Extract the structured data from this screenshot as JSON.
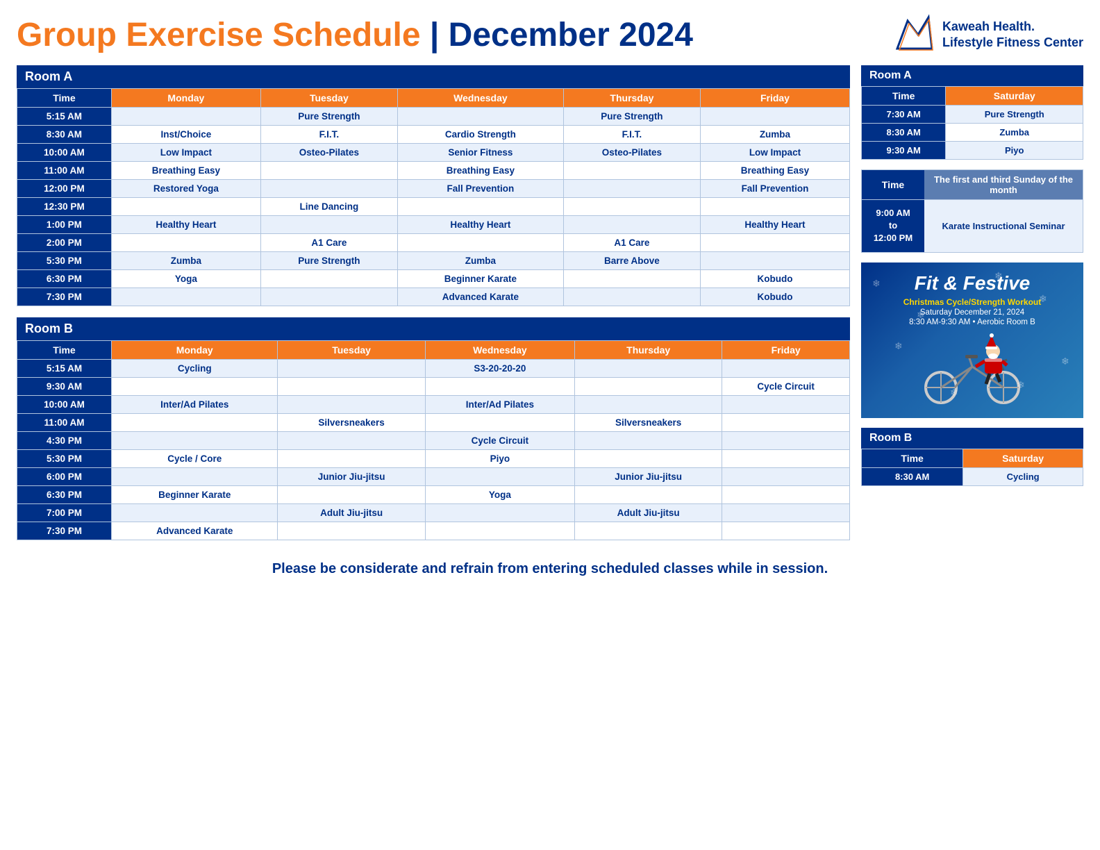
{
  "header": {
    "title_part1": "Group Exercise Schedule",
    "separator": " | ",
    "title_part2": "December 2024",
    "logo_line1": "Kaweah Health.",
    "logo_line2": "Lifestyle Fitness Center"
  },
  "roomA_main": {
    "title": "Room A",
    "columns": [
      "Time",
      "Monday",
      "Tuesday",
      "Wednesday",
      "Thursday",
      "Friday"
    ],
    "rows": [
      [
        "5:15 AM",
        "",
        "Pure Strength",
        "",
        "Pure Strength",
        ""
      ],
      [
        "8:30 AM",
        "Inst/Choice",
        "F.I.T.",
        "Cardio Strength",
        "F.I.T.",
        "Zumba"
      ],
      [
        "10:00 AM",
        "Low Impact",
        "Osteo-Pilates",
        "Senior Fitness",
        "Osteo-Pilates",
        "Low Impact"
      ],
      [
        "11:00 AM",
        "Breathing Easy",
        "",
        "Breathing Easy",
        "",
        "Breathing Easy"
      ],
      [
        "12:00 PM",
        "Restored Yoga",
        "",
        "Fall Prevention",
        "",
        "Fall Prevention"
      ],
      [
        "12:30 PM",
        "",
        "Line Dancing",
        "",
        "",
        ""
      ],
      [
        "1:00 PM",
        "Healthy Heart",
        "",
        "Healthy Heart",
        "",
        "Healthy Heart"
      ],
      [
        "2:00 PM",
        "",
        "A1 Care",
        "",
        "A1 Care",
        ""
      ],
      [
        "5:30 PM",
        "Zumba",
        "Pure Strength",
        "Zumba",
        "Barre Above",
        ""
      ],
      [
        "6:30 PM",
        "Yoga",
        "",
        "Beginner Karate",
        "",
        "Kobudo"
      ],
      [
        "7:30 PM",
        "",
        "",
        "Advanced Karate",
        "",
        "Kobudo"
      ]
    ]
  },
  "roomB_main": {
    "title": "Room B",
    "columns": [
      "Time",
      "Monday",
      "Tuesday",
      "Wednesday",
      "Thursday",
      "Friday"
    ],
    "rows": [
      [
        "5:15 AM",
        "Cycling",
        "",
        "S3-20-20-20",
        "",
        ""
      ],
      [
        "9:30 AM",
        "",
        "",
        "",
        "",
        "Cycle Circuit"
      ],
      [
        "10:00 AM",
        "Inter/Ad Pilates",
        "",
        "Inter/Ad Pilates",
        "",
        ""
      ],
      [
        "11:00 AM",
        "",
        "Silversneakers",
        "",
        "Silversneakers",
        ""
      ],
      [
        "4:30 PM",
        "",
        "",
        "Cycle Circuit",
        "",
        ""
      ],
      [
        "5:30 PM",
        "Cycle / Core",
        "",
        "Piyo",
        "",
        ""
      ],
      [
        "6:00 PM",
        "",
        "Junior Jiu-jitsu",
        "",
        "Junior Jiu-jitsu",
        ""
      ],
      [
        "6:30 PM",
        "Beginner Karate",
        "",
        "Yoga",
        "",
        ""
      ],
      [
        "7:00 PM",
        "",
        "Adult Jiu-jitsu",
        "",
        "Adult Jiu-jitsu",
        ""
      ],
      [
        "7:30 PM",
        "Advanced Karate",
        "",
        "",
        "",
        ""
      ]
    ]
  },
  "roomA_saturday": {
    "title": "Room A",
    "columns": [
      "Time",
      "Saturday"
    ],
    "rows": [
      [
        "7:30 AM",
        "Pure Strength"
      ],
      [
        "8:30 AM",
        "Zumba"
      ],
      [
        "9:30 AM",
        "Piyo"
      ]
    ]
  },
  "sunday_block": {
    "time_label": "Time",
    "day_label": "The first and third Sunday of the month",
    "time_val": "9:00 AM\nto\n12:00 PM",
    "class_val": "Karate Instructional Seminar"
  },
  "fit_festive": {
    "title": "Fit & Festive",
    "subtitle": "Christmas Cycle/Strength Workout",
    "detail1": "Saturday December 21, 2024",
    "detail2": "8:30 AM-9:30 AM  •  Aerobic Room B"
  },
  "roomB_saturday": {
    "title": "Room B",
    "columns": [
      "Time",
      "Saturday"
    ],
    "rows": [
      [
        "8:30 AM",
        "Cycling"
      ]
    ]
  },
  "footer": {
    "note": "Please be considerate and refrain from entering scheduled classes while in session."
  }
}
